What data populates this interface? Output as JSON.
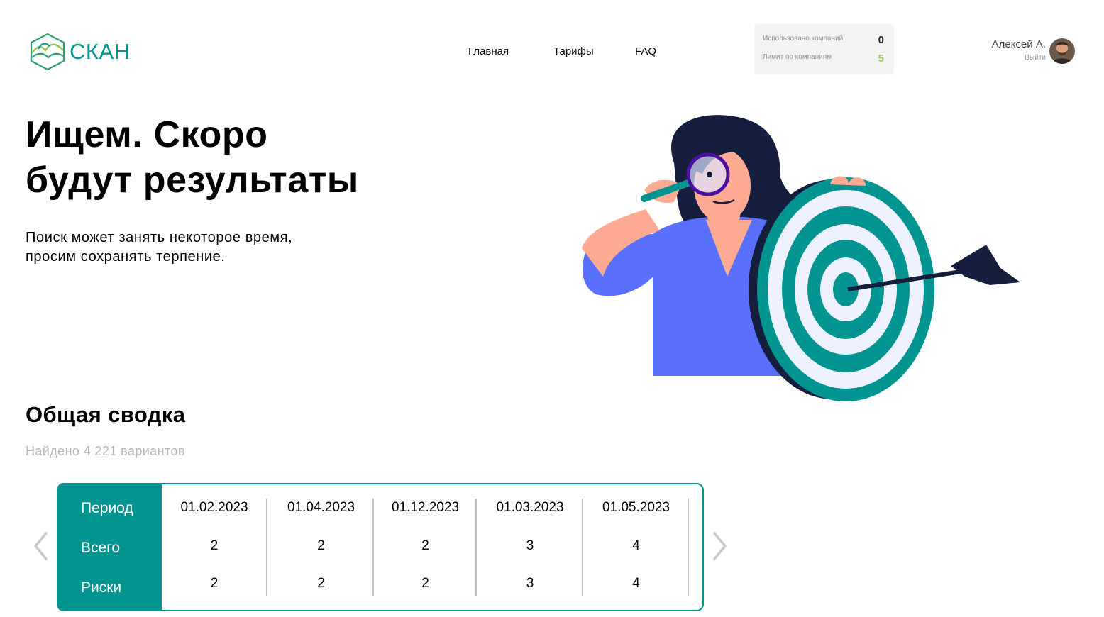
{
  "header": {
    "logo_text": "СКАН",
    "nav": [
      "Главная",
      "Тарифы",
      "FAQ"
    ],
    "limits": {
      "used_label": "Использовано компаний",
      "used_value": "0",
      "limit_label": "Лимит по компаниям",
      "limit_value": "5"
    },
    "user": {
      "name": "Алексей А.",
      "logout_label": "Выйти"
    }
  },
  "hero": {
    "title_line1": "Ищем. Скоро",
    "title_line2": "будут результаты",
    "subtitle_line1": "Поиск может занять некоторое время,",
    "subtitle_line2": "просим сохранять терпение."
  },
  "summary": {
    "title": "Общая сводка",
    "found_text": "Найдено 4 221 вариантов",
    "row_labels": [
      "Период",
      "Всего",
      "Риски"
    ],
    "columns": [
      {
        "period": "01.02.2023",
        "total": "2",
        "risks": "2"
      },
      {
        "period": "01.04.2023",
        "total": "2",
        "risks": "2"
      },
      {
        "period": "01.12.2023",
        "total": "2",
        "risks": "2"
      },
      {
        "period": "01.03.2023",
        "total": "3",
        "risks": "3"
      },
      {
        "period": "01.05.2023",
        "total": "4",
        "risks": "4"
      }
    ],
    "prev_icon": "chevron-left-icon",
    "next_icon": "chevron-right-icon"
  },
  "colors": {
    "brand": "#029491",
    "limit_value": "#8ac540",
    "muted": "#b7b7b7"
  }
}
